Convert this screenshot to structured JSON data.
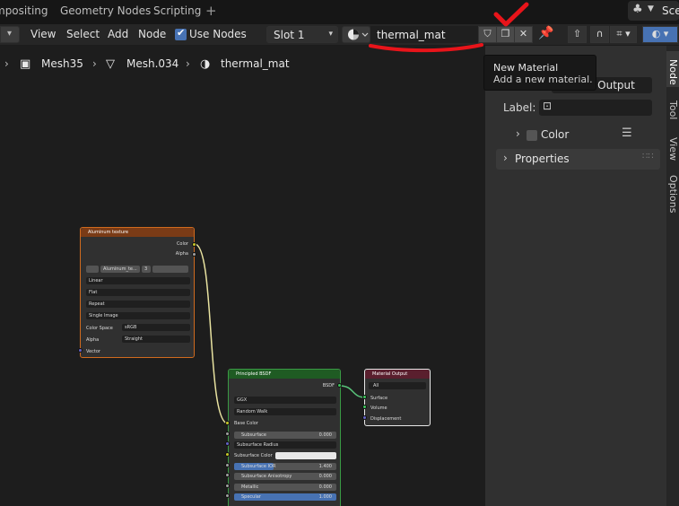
{
  "workspace_tabs": [
    "mpositing",
    "Geometry Nodes",
    "Scripting"
  ],
  "add_tab_symbol": "+",
  "scene_label": "Sce",
  "header": {
    "menus": [
      "View",
      "Select",
      "Add",
      "Node"
    ],
    "use_nodes_label": "Use Nodes",
    "slot_value": "Slot 1",
    "material_name": "thermal_mat"
  },
  "breadcrumb": [
    "Mesh35",
    "Mesh.034",
    "thermal_mat"
  ],
  "tooltip": {
    "title": "New Material",
    "description": "Add a new material."
  },
  "sidebar": {
    "name_partial": "l Output",
    "label_field_label": "Label:",
    "color_section": "Color",
    "properties_section": "Properties",
    "tabs": [
      "Node",
      "Tool",
      "View",
      "Options"
    ]
  },
  "nodes": {
    "image_texture": {
      "title": "Aluminum texture",
      "out_color": "Color",
      "out_alpha": "Alpha",
      "image_name": "Aluminum_te...",
      "users": "3",
      "interpolation": "Linear",
      "projection": "Flat",
      "extension": "Repeat",
      "source": "Single Image",
      "color_space_label": "Color Space",
      "color_space": "sRGB",
      "alpha_label": "Alpha",
      "alpha_mode": "Straight",
      "in_vector": "Vector"
    },
    "principled": {
      "title": "Principled BSDF",
      "out_bsdf": "BSDF",
      "distribution": "GGX",
      "sss_method": "Random Walk",
      "base_color": "Base Color",
      "subsurface": "Subsurface",
      "subsurface_val": "0.000",
      "subsurface_radius": "Subsurface Radius",
      "subsurface_color": "Subsurface Color",
      "subsurface_ior": "Subsurface IOR",
      "subsurface_ior_val": "1.400",
      "subsurface_aniso": "Subsurface Anisotropy",
      "subsurface_aniso_val": "0.000",
      "metallic": "Metallic",
      "metallic_val": "0.000",
      "specular": "Specular",
      "specular_val": "1.000"
    },
    "material_output": {
      "title": "Material Output",
      "target": "All",
      "surface": "Surface",
      "volume": "Volume",
      "displacement": "Displacement"
    }
  },
  "colors": {
    "accent_blue": "#4772b3",
    "texture_header": "#7a3b16",
    "shader_header": "#1f5b23",
    "output_header": "#5a1f2e",
    "annotation_red": "#e8141a"
  }
}
